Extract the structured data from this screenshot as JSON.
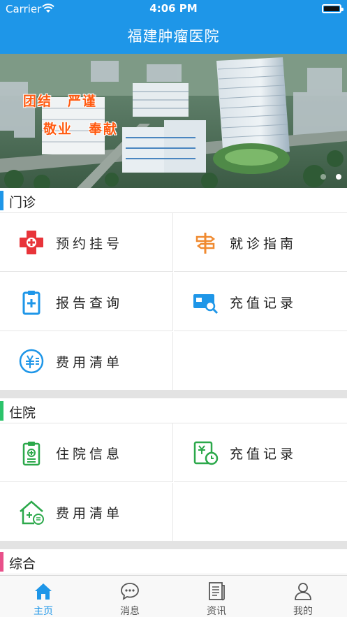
{
  "status_bar": {
    "carrier": "Carrier",
    "time": "4:06 PM"
  },
  "nav": {
    "title": "福建肿瘤医院"
  },
  "banner": {
    "slogans": [
      "团结",
      "严谨",
      "敬业",
      "奉献"
    ],
    "active_slide": 2,
    "slide_count": 2
  },
  "sections": {
    "outpatient": {
      "title": "门诊",
      "accent": "#1e96e8",
      "items": [
        {
          "label": "预约挂号",
          "icon": "medical-cross-icon"
        },
        {
          "label": "就诊指南",
          "icon": "signpost-icon"
        },
        {
          "label": "报告查询",
          "icon": "clipboard-report-icon"
        },
        {
          "label": "充值记录",
          "icon": "card-search-icon"
        },
        {
          "label": "费用清单",
          "icon": "yen-circle-icon"
        }
      ]
    },
    "inpatient": {
      "title": "住院",
      "accent": "#2cc36b",
      "items": [
        {
          "label": "住院信息",
          "icon": "clipboard-medical-icon"
        },
        {
          "label": "充值记录",
          "icon": "yen-clock-icon"
        },
        {
          "label": "费用清单",
          "icon": "house-list-icon"
        }
      ]
    },
    "general": {
      "title": "综合",
      "accent": "#e8508a"
    }
  },
  "tabbar": {
    "items": [
      {
        "label": "主页",
        "icon": "home-icon",
        "active": true
      },
      {
        "label": "消息",
        "icon": "chat-bubble-icon",
        "active": false
      },
      {
        "label": "资讯",
        "icon": "news-icon",
        "active": false
      },
      {
        "label": "我的",
        "icon": "user-icon",
        "active": false
      }
    ]
  },
  "colors": {
    "brand": "#1e96e8",
    "outpatient_icon": "#1e96e8",
    "registration_icon": "#e8343a",
    "guide_icon": "#f08a30",
    "inpatient_icon": "#2ba84a"
  }
}
